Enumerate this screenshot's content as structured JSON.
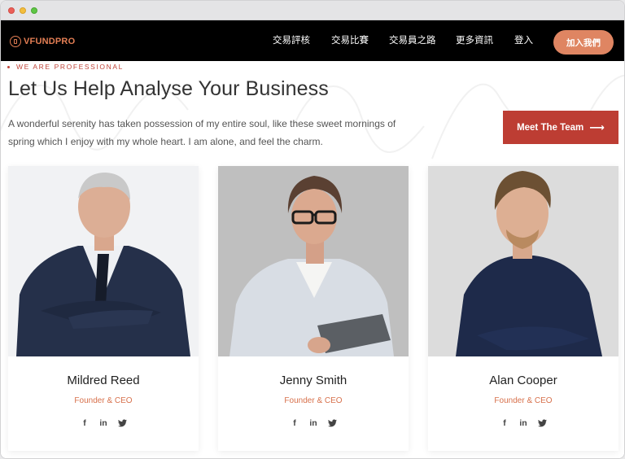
{
  "brand": {
    "logo_text": "VFUNDPRO",
    "accent_color": "#e37e54",
    "primary_red": "#bd3d33"
  },
  "nav": {
    "links": [
      "交易評核",
      "交易比賽",
      "交易員之路",
      "更多資訊",
      "登入"
    ],
    "join_button": "加入我們"
  },
  "hero": {
    "tagline": "WE ARE PROFESSIONAL",
    "headline": "Let Us Help Analyse Your Business",
    "intro": "A wonderful serenity has taken possession of my entire soul, like these sweet mornings of spring which I enjoy with my whole heart. I am alone, and feel the charm.",
    "cta_label": "Meet The Team",
    "cta_icon": "arrow-right-icon"
  },
  "team": [
    {
      "name": "Mildred Reed",
      "role": "Founder & CEO",
      "socials": [
        "f",
        "in",
        "t"
      ]
    },
    {
      "name": "Jenny Smith",
      "role": "Founder & CEO",
      "socials": [
        "f",
        "in",
        "t"
      ]
    },
    {
      "name": "Alan Cooper",
      "role": "Founder & CEO",
      "socials": [
        "f",
        "in",
        "t"
      ]
    }
  ]
}
